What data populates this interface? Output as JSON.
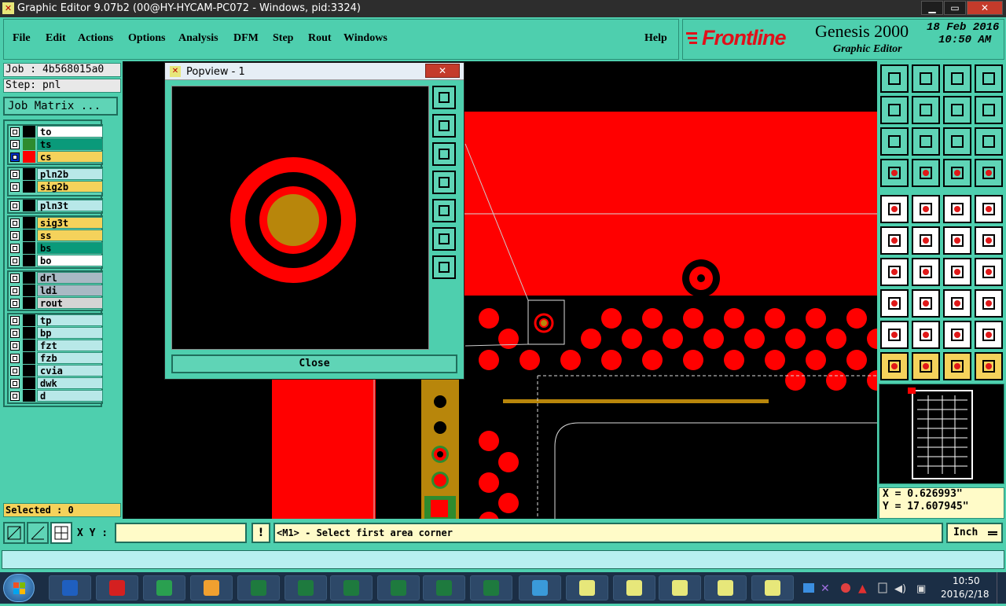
{
  "window": {
    "title": "Graphic Editor 9.07b2 (00@HY-HYCAM-PC072 - Windows, pid:3324)",
    "min": "▁",
    "max": "▭",
    "close": "✕"
  },
  "menu": [
    "File",
    "Edit",
    "Actions",
    "Options",
    "Analysis",
    "DFM",
    "Step",
    "Rout",
    "Windows"
  ],
  "help": "Help",
  "brand": {
    "logo": "Frontline",
    "product": "Genesis 2000",
    "subtitle": "Graphic Editor",
    "date": "18 Feb 2016",
    "time": "10:50 AM"
  },
  "job": {
    "job_label": "Job : 4b568015a0",
    "step_label": "Step: pnl",
    "matrix_button": "Job Matrix ..."
  },
  "layers_group1": [
    {
      "name": "to",
      "color": "#ffffff",
      "sw": "#000000"
    },
    {
      "name": "ts",
      "color": "#0a9a7a",
      "sw": "#2e8b2e"
    },
    {
      "name": "cs",
      "color": "#f5d25b",
      "sw": "#ff0000"
    }
  ],
  "layers_group2": [
    {
      "name": "pln2b",
      "color": "#b8e8e8",
      "sw": "#000000"
    },
    {
      "name": "sig2b",
      "color": "#f5d25b",
      "sw": "#000000"
    }
  ],
  "layers_group3": [
    {
      "name": "pln3t",
      "color": "#b8e8e8",
      "sw": "#000000"
    }
  ],
  "layers_group4": [
    {
      "name": "sig3t",
      "color": "#f5d25b",
      "sw": "#000000"
    },
    {
      "name": "ss",
      "color": "#f5d25b",
      "sw": "#000000"
    },
    {
      "name": "bs",
      "color": "#0a9a7a",
      "sw": "#000000"
    },
    {
      "name": "bo",
      "color": "#ffffff",
      "sw": "#000000"
    }
  ],
  "layers_group5": [
    {
      "name": "drl",
      "color": "#a9b9c4",
      "sw": "#000000"
    },
    {
      "name": "ldi",
      "color": "#a9b9c4",
      "sw": "#000000"
    },
    {
      "name": "rout",
      "color": "#d4d4d4",
      "sw": "#000000"
    }
  ],
  "layers_group6": [
    {
      "name": "tp",
      "color": "#b8e8e8",
      "sw": "#000000"
    },
    {
      "name": "bp",
      "color": "#b8e8e8",
      "sw": "#000000"
    },
    {
      "name": "fzt",
      "color": "#b8e8e8",
      "sw": "#000000"
    },
    {
      "name": "fzb",
      "color": "#b8e8e8",
      "sw": "#000000"
    },
    {
      "name": "cvia",
      "color": "#b8e8e8",
      "sw": "#000000"
    },
    {
      "name": "dwk",
      "color": "#b8e8e8",
      "sw": "#000000"
    },
    {
      "name": "d",
      "color": "#b8e8e8",
      "sw": "#000000"
    }
  ],
  "selected": "Selected : 0",
  "popview": {
    "title": "Popview - 1",
    "close_label": "Close"
  },
  "coords": {
    "x": "X = 0.626993\"",
    "y": "Y = 17.607945\""
  },
  "status": {
    "xy_label": "X Y :",
    "xy_value": "",
    "message": "<M1> - Select first area corner",
    "units": "Inch"
  },
  "tray": {
    "time": "10:50",
    "date": "2016/2/18"
  }
}
